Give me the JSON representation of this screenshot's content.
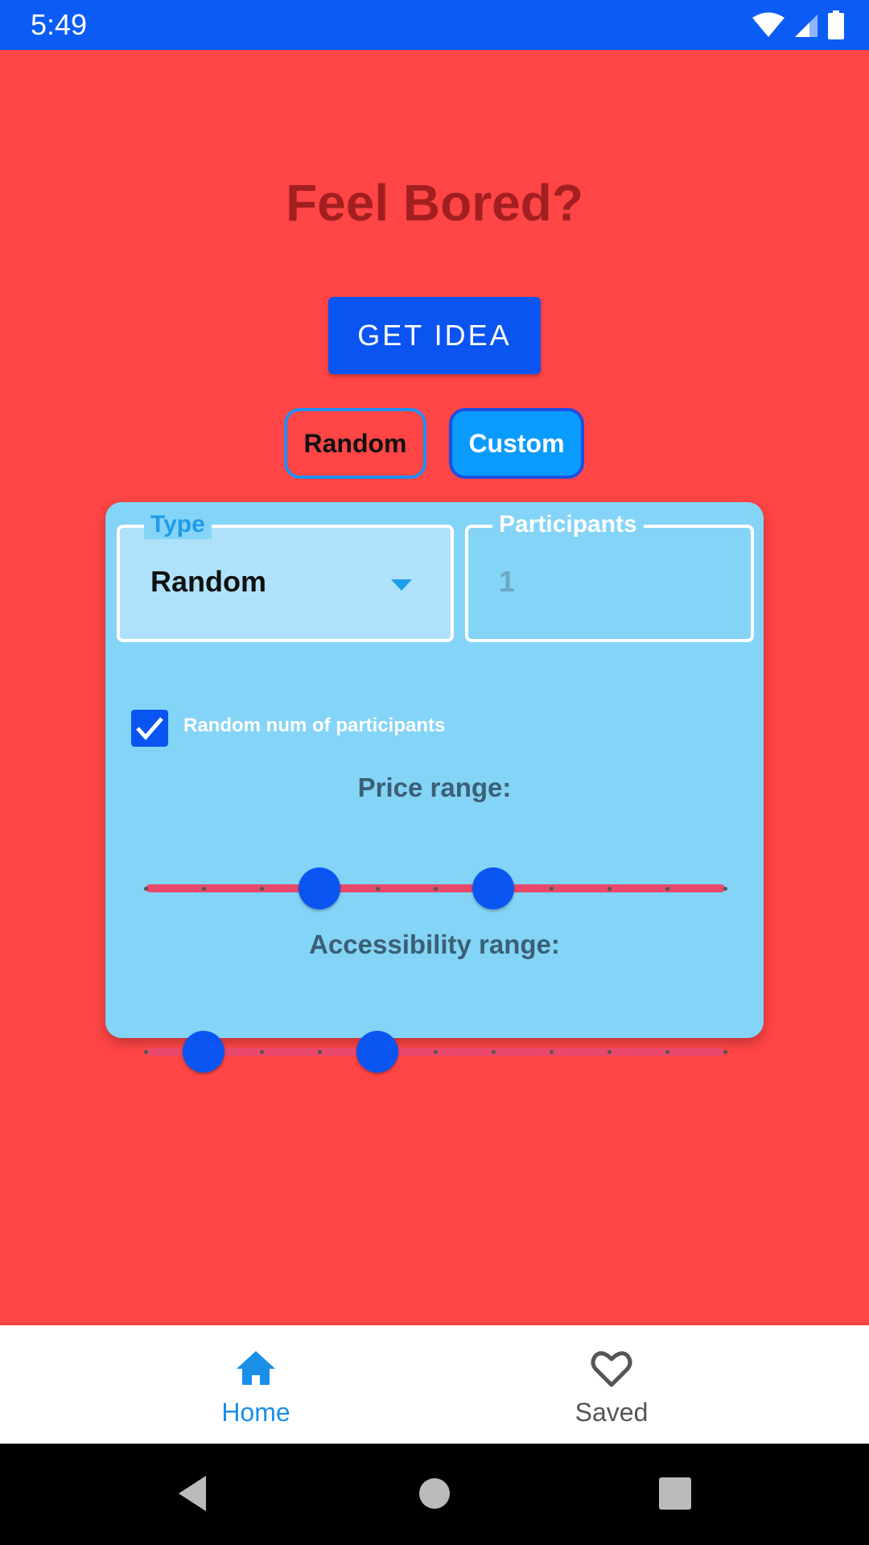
{
  "status_bar": {
    "time": "5:49",
    "icons": [
      "wifi-icon",
      "cell-signal-icon",
      "battery-icon"
    ],
    "color": "#0a5cf5"
  },
  "app": {
    "background_color": "#ff4545",
    "title": "Feel Bored?",
    "get_idea_label": "GET IDEA",
    "mode_buttons": {
      "random_label": "Random",
      "custom_label": "Custom",
      "selected": "Custom"
    }
  },
  "custom_panel": {
    "type_field": {
      "label": "Type",
      "value": "Random"
    },
    "participants_field": {
      "label": "Participants",
      "value": "1"
    },
    "random_participants_checkbox": {
      "label": "Random num of participants",
      "checked": true
    },
    "price_range": {
      "label": "Price range:",
      "steps": 10,
      "low": 3,
      "high": 6
    },
    "accessibility_range": {
      "label": "Accessibility range:",
      "steps": 10,
      "low": 1,
      "high": 4
    }
  },
  "bottom_nav": {
    "items": [
      {
        "label": "Home",
        "icon": "home-icon",
        "active": true
      },
      {
        "label": "Saved",
        "icon": "heart-outline-icon",
        "active": false
      }
    ]
  },
  "system_nav": {
    "buttons": [
      "back-icon",
      "home-circle-icon",
      "recents-icon"
    ]
  }
}
